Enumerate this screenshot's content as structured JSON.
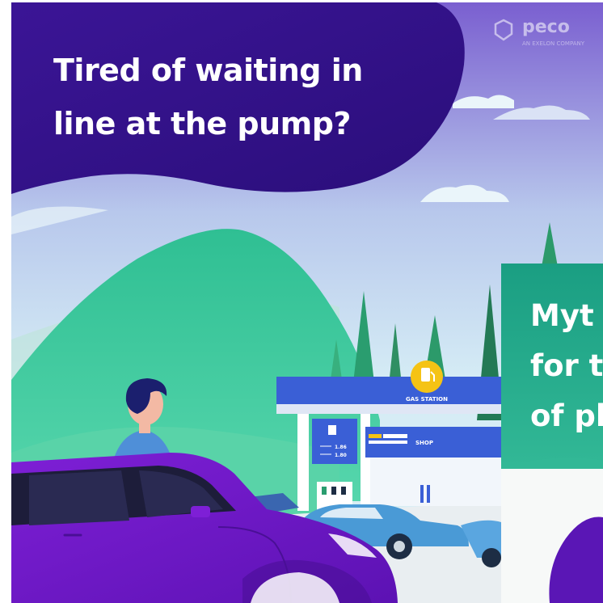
{
  "headline": {
    "lines": [
      "Tired of waiting in",
      "line at the pump?"
    ]
  },
  "brand": {
    "name": "peco",
    "tagline": "AN EXELON COMPANY"
  },
  "station": {
    "sign": "GAS STATION",
    "shop_sign": "SHOP",
    "price_1": "1.86",
    "price_2": "1.80",
    "pump_icon": "fuel-pump-icon"
  },
  "next_card": {
    "lines": [
      "Myt",
      "for t",
      "of pl"
    ]
  },
  "colors": {
    "headline_bubble": "#35128c",
    "next_card_top": "#1a9e82",
    "car_purple": "#6b17c4",
    "canopy_blue": "#3a5fd6",
    "sign_yellow": "#f5c315",
    "hill_green": "#3fc99c",
    "sky": "#cde6f3"
  }
}
